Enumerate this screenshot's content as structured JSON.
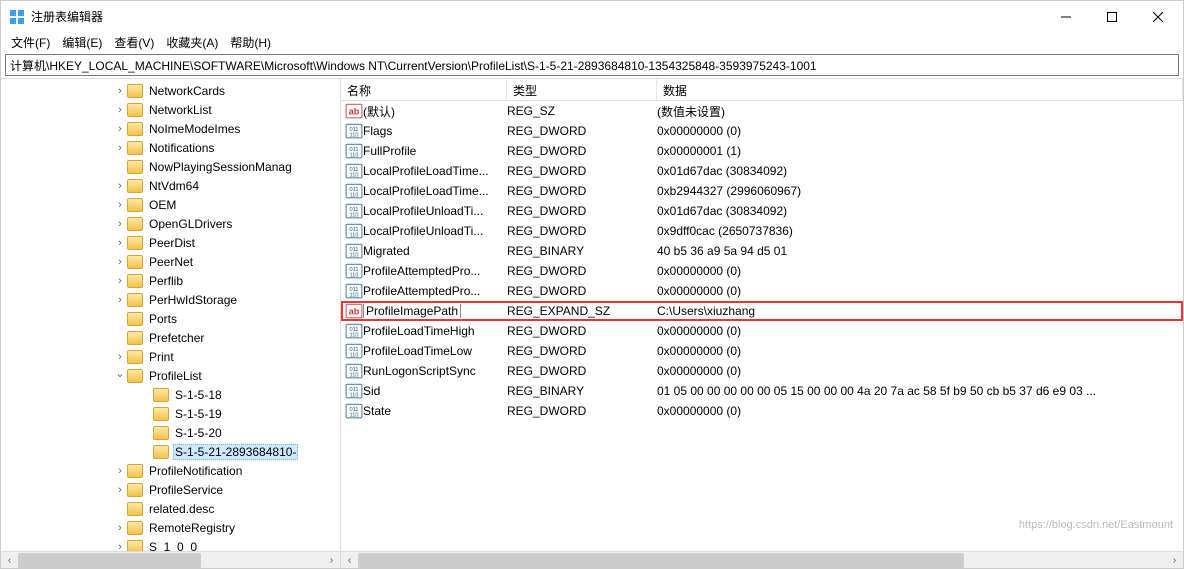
{
  "title": "注册表编辑器",
  "menus": {
    "file": "文件(F)",
    "edit": "编辑(E)",
    "view": "查看(V)",
    "fav": "收藏夹(A)",
    "help": "帮助(H)"
  },
  "address": "计算机\\HKEY_LOCAL_MACHINE\\SOFTWARE\\Microsoft\\Windows NT\\CurrentVersion\\ProfileList\\S-1-5-21-2893684810-1354325848-3593975243-1001",
  "columns": {
    "name": "名称",
    "type": "类型",
    "data": "数据"
  },
  "tree": [
    {
      "label": "NetworkCards",
      "indent": 112,
      "tw": "closed"
    },
    {
      "label": "NetworkList",
      "indent": 112,
      "tw": "closed"
    },
    {
      "label": "NoImeModeImes",
      "indent": 112,
      "tw": "closed"
    },
    {
      "label": "Notifications",
      "indent": 112,
      "tw": "closed"
    },
    {
      "label": "NowPlayingSessionManag",
      "indent": 112,
      "tw": "none"
    },
    {
      "label": "NtVdm64",
      "indent": 112,
      "tw": "closed"
    },
    {
      "label": "OEM",
      "indent": 112,
      "tw": "closed"
    },
    {
      "label": "OpenGLDrivers",
      "indent": 112,
      "tw": "closed"
    },
    {
      "label": "PeerDist",
      "indent": 112,
      "tw": "closed"
    },
    {
      "label": "PeerNet",
      "indent": 112,
      "tw": "closed"
    },
    {
      "label": "Perflib",
      "indent": 112,
      "tw": "closed"
    },
    {
      "label": "PerHwIdStorage",
      "indent": 112,
      "tw": "closed"
    },
    {
      "label": "Ports",
      "indent": 112,
      "tw": "none"
    },
    {
      "label": "Prefetcher",
      "indent": 112,
      "tw": "none"
    },
    {
      "label": "Print",
      "indent": 112,
      "tw": "closed"
    },
    {
      "label": "ProfileList",
      "indent": 112,
      "tw": "open"
    },
    {
      "label": "S-1-5-18",
      "indent": 138,
      "tw": "none"
    },
    {
      "label": "S-1-5-19",
      "indent": 138,
      "tw": "none"
    },
    {
      "label": "S-1-5-20",
      "indent": 138,
      "tw": "none"
    },
    {
      "label": "S-1-5-21-2893684810-",
      "indent": 138,
      "tw": "none",
      "selected": true
    },
    {
      "label": "ProfileNotification",
      "indent": 112,
      "tw": "closed"
    },
    {
      "label": "ProfileService",
      "indent": 112,
      "tw": "closed"
    },
    {
      "label": "related.desc",
      "indent": 112,
      "tw": "none"
    },
    {
      "label": "RemoteRegistry",
      "indent": 112,
      "tw": "closed"
    },
    {
      "label": "S_1_0_0",
      "indent": 112,
      "tw": "closed"
    }
  ],
  "values": [
    {
      "icon": "str",
      "name": "(默认)",
      "type": "REG_SZ",
      "data": "(数值未设置)"
    },
    {
      "icon": "bin",
      "name": "Flags",
      "type": "REG_DWORD",
      "data": "0x00000000 (0)"
    },
    {
      "icon": "bin",
      "name": "FullProfile",
      "type": "REG_DWORD",
      "data": "0x00000001 (1)"
    },
    {
      "icon": "bin",
      "name": "LocalProfileLoadTime...",
      "type": "REG_DWORD",
      "data": "0x01d67dac (30834092)"
    },
    {
      "icon": "bin",
      "name": "LocalProfileLoadTime...",
      "type": "REG_DWORD",
      "data": "0xb2944327 (2996060967)"
    },
    {
      "icon": "bin",
      "name": "LocalProfileUnloadTi...",
      "type": "REG_DWORD",
      "data": "0x01d67dac (30834092)"
    },
    {
      "icon": "bin",
      "name": "LocalProfileUnloadTi...",
      "type": "REG_DWORD",
      "data": "0x9dff0cac (2650737836)"
    },
    {
      "icon": "bin",
      "name": "Migrated",
      "type": "REG_BINARY",
      "data": "40 b5 36 a9 5a 94 d5 01"
    },
    {
      "icon": "bin",
      "name": "ProfileAttemptedPro...",
      "type": "REG_DWORD",
      "data": "0x00000000 (0)"
    },
    {
      "icon": "bin",
      "name": "ProfileAttemptedPro...",
      "type": "REG_DWORD",
      "data": "0x00000000 (0)"
    },
    {
      "icon": "str",
      "name": "ProfileImagePath",
      "type": "REG_EXPAND_SZ",
      "data": "C:\\Users\\xiuzhang",
      "hl": true
    },
    {
      "icon": "bin",
      "name": "ProfileLoadTimeHigh",
      "type": "REG_DWORD",
      "data": "0x00000000 (0)"
    },
    {
      "icon": "bin",
      "name": "ProfileLoadTimeLow",
      "type": "REG_DWORD",
      "data": "0x00000000 (0)"
    },
    {
      "icon": "bin",
      "name": "RunLogonScriptSync",
      "type": "REG_DWORD",
      "data": "0x00000000 (0)"
    },
    {
      "icon": "bin",
      "name": "Sid",
      "type": "REG_BINARY",
      "data": "01 05 00 00 00 00 00 05 15 00 00 00 4a 20 7a ac 58 5f b9 50 cb b5 37 d6 e9 03 ..."
    },
    {
      "icon": "bin",
      "name": "State",
      "type": "REG_DWORD",
      "data": "0x00000000 (0)"
    }
  ],
  "watermark": "https://blog.csdn.net/Eastmount"
}
